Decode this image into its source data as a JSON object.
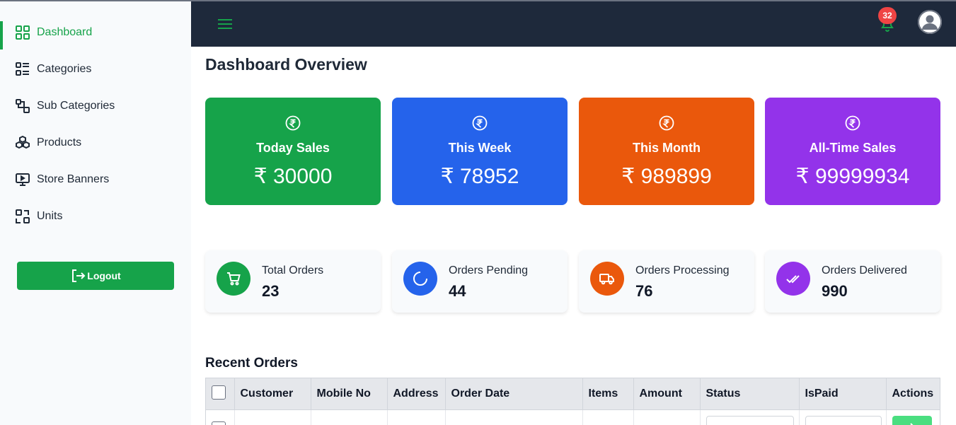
{
  "sidebar": {
    "items": [
      {
        "label": "Dashboard",
        "icon": "grid-icon",
        "active": true
      },
      {
        "label": "Categories",
        "icon": "list-icon"
      },
      {
        "label": "Sub Categories",
        "icon": "shapes-icon"
      },
      {
        "label": "Products",
        "icon": "boxes-icon"
      },
      {
        "label": "Store Banners",
        "icon": "monitor-play-icon"
      },
      {
        "label": "Units",
        "icon": "units-icon"
      }
    ],
    "logout_label": "Logout"
  },
  "header": {
    "notification_count": "32"
  },
  "page_title": "Dashboard Overview",
  "sales_cards": [
    {
      "label": "Today Sales",
      "value": "₹ 30000",
      "color": "#16a34a"
    },
    {
      "label": "This Week",
      "value": "₹ 78952",
      "color": "#2563eb"
    },
    {
      "label": "This Month",
      "value": "₹ 989899",
      "color": "#ea580c"
    },
    {
      "label": "All-Time Sales",
      "value": "₹ 99999934",
      "color": "#9333ea"
    }
  ],
  "order_stats": [
    {
      "label": "Total Orders",
      "value": "23",
      "icon": "cart-icon",
      "color": "#16a34a"
    },
    {
      "label": "Orders Pending",
      "value": "44",
      "icon": "spinner-icon",
      "color": "#2563eb"
    },
    {
      "label": "Orders Processing",
      "value": "76",
      "icon": "truck-icon",
      "color": "#ea580c"
    },
    {
      "label": "Orders Delivered",
      "value": "990",
      "icon": "double-check-icon",
      "color": "#9333ea"
    }
  ],
  "recent_orders": {
    "title": "Recent Orders",
    "columns": [
      "Customer",
      "Mobile No",
      "Address",
      "Order Date",
      "Items",
      "Amount",
      "Status",
      "IsPaid",
      "Actions"
    ]
  }
}
